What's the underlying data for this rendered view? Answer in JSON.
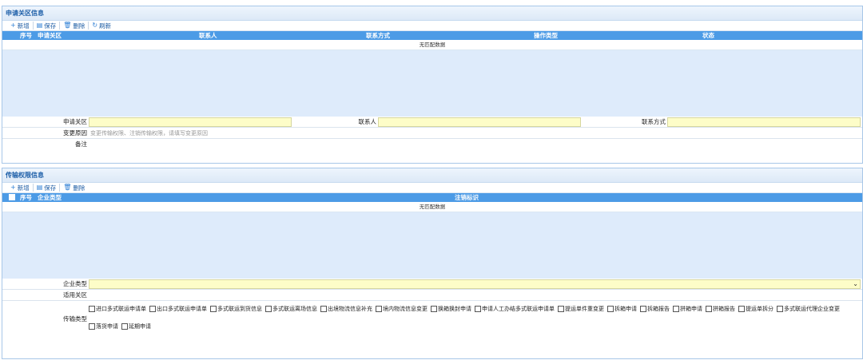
{
  "section1": {
    "title": "申请关区信息",
    "toolbar": [
      {
        "icon": "+",
        "label": "新增",
        "name": "add"
      },
      {
        "icon": "▤",
        "label": "保存",
        "name": "save"
      },
      {
        "icon": "🗑",
        "label": "删除",
        "name": "delete"
      },
      {
        "icon": "↻",
        "label": "刷新",
        "name": "refresh"
      }
    ],
    "columns": [
      "序号",
      "申请关区",
      "联系人",
      "联系方式",
      "操作类型",
      "状态"
    ],
    "no_data": "无匹配数据",
    "form": {
      "apply_customs_label": "申请关区",
      "contact_label": "联系人",
      "contact_method_label": "联系方式",
      "reason_label": "变更原因",
      "reason_placeholder": "变更传输权限、注销传输权限，请填写变更原因",
      "remark_label": "备注"
    }
  },
  "section2": {
    "title": "传输权限信息",
    "toolbar": [
      {
        "icon": "+",
        "label": "新增",
        "name": "add"
      },
      {
        "icon": "▤",
        "label": "保存",
        "name": "save"
      },
      {
        "icon": "🗑",
        "label": "删除",
        "name": "delete"
      }
    ],
    "columns": [
      "序号",
      "企业类型",
      "注销标识"
    ],
    "no_data": "无匹配数据",
    "form": {
      "enterprise_type_label": "企业类型",
      "applicable_customs_label": "适用关区",
      "transmission_type_label": "传输类型",
      "transmission_types": [
        "进口多式联运申请单",
        "出口多式联运申请单",
        "多式联运到货信息",
        "多式联运离场信息",
        "出境物流信息补充",
        "境内物流信息变更",
        "换箱换封申请",
        "申请人工办结多式联运申请单",
        "提运单件重变更",
        "拆箱申请",
        "拆箱报告",
        "拼箱申请",
        "拼箱报告",
        "提运单拆分",
        "多式联运代理企业变更",
        "落货申请",
        "延期申请"
      ]
    }
  },
  "colors": {
    "header_blue": "#4c9be6",
    "grid_body": "#deebfb",
    "input_yellow": "#fdfdc8",
    "title_blue": "#1c5ea8"
  }
}
